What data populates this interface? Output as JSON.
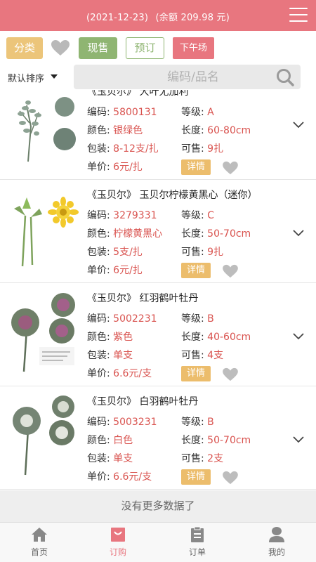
{
  "header": {
    "date": "(2021-12-23)",
    "balance": "(余额 209.98 元)"
  },
  "filters": {
    "category": "分类",
    "in_stock": "现售",
    "preorder": "预订",
    "afternoon": "下午场"
  },
  "sort": {
    "label": "默认排序"
  },
  "search": {
    "placeholder": "编码/品名"
  },
  "labels": {
    "code": "编码:",
    "grade": "等级:",
    "color": "颜色:",
    "length": "长度:",
    "pack": "包装:",
    "available": "可售:",
    "price": "单价:",
    "detail": "详情"
  },
  "items": [
    {
      "name": "《玉贝尔》 大叶尤加利",
      "code": "5800131",
      "grade": "A",
      "color": "银绿色",
      "length": "60-80cm",
      "pack": "8-12支/扎",
      "available": "9扎",
      "price": "6元/扎"
    },
    {
      "name": "《玉贝尔》 玉贝尔柠檬黄黑心（迷你）",
      "code": "3279331",
      "grade": "C",
      "color": "柠檬黄黑心",
      "length": "50-70cm",
      "pack": "5支/扎",
      "available": "9扎",
      "price": "6元/扎"
    },
    {
      "name": "《玉贝尔》 红羽鹤叶牡丹",
      "code": "5002231",
      "grade": "B",
      "color": "紫色",
      "length": "40-60cm",
      "pack": "单支",
      "available": "4支",
      "price": "6.6元/支"
    },
    {
      "name": "《玉贝尔》 白羽鹤叶牡丹",
      "code": "5003231",
      "grade": "B",
      "color": "白色",
      "length": "50-70cm",
      "pack": "单支",
      "available": "2支",
      "price": "6.6元/支"
    }
  ],
  "footer": {
    "no_more": "没有更多数据了"
  },
  "tabs": [
    {
      "label": "首页",
      "icon": "home-icon"
    },
    {
      "label": "订购",
      "icon": "shopping-bag-icon"
    },
    {
      "label": "订单",
      "icon": "order-list-icon"
    },
    {
      "label": "我的",
      "icon": "user-icon"
    }
  ],
  "colors": {
    "header": "#e8767f",
    "accent_gold": "#ecc57a",
    "accent_green": "#8fb572",
    "value_red": "#d9534f"
  }
}
